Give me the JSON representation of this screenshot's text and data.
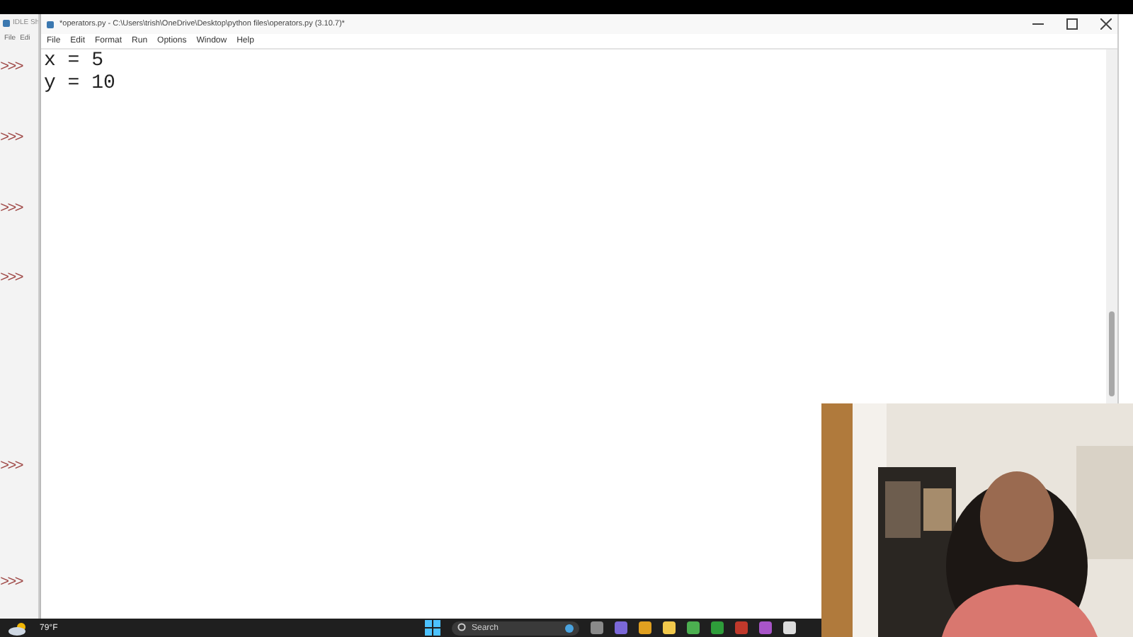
{
  "shell_window": {
    "title": "IDLE Sh",
    "menu": [
      "File",
      "Edi"
    ],
    "prompts": [
      ">>>",
      ">>>",
      ">>>",
      ">>>",
      ">>>",
      ">>>"
    ]
  },
  "editor_window": {
    "title": "*operators.py - C:\\Users\\trish\\OneDrive\\Desktop\\python files\\operators.py (3.10.7)*",
    "menu": [
      "File",
      "Edit",
      "Format",
      "Run",
      "Options",
      "Window",
      "Help"
    ],
    "code_lines": [
      "x = 5",
      "y = 10"
    ]
  },
  "taskbar": {
    "weather": "79°F",
    "search": {
      "placeholder": "Search"
    }
  }
}
